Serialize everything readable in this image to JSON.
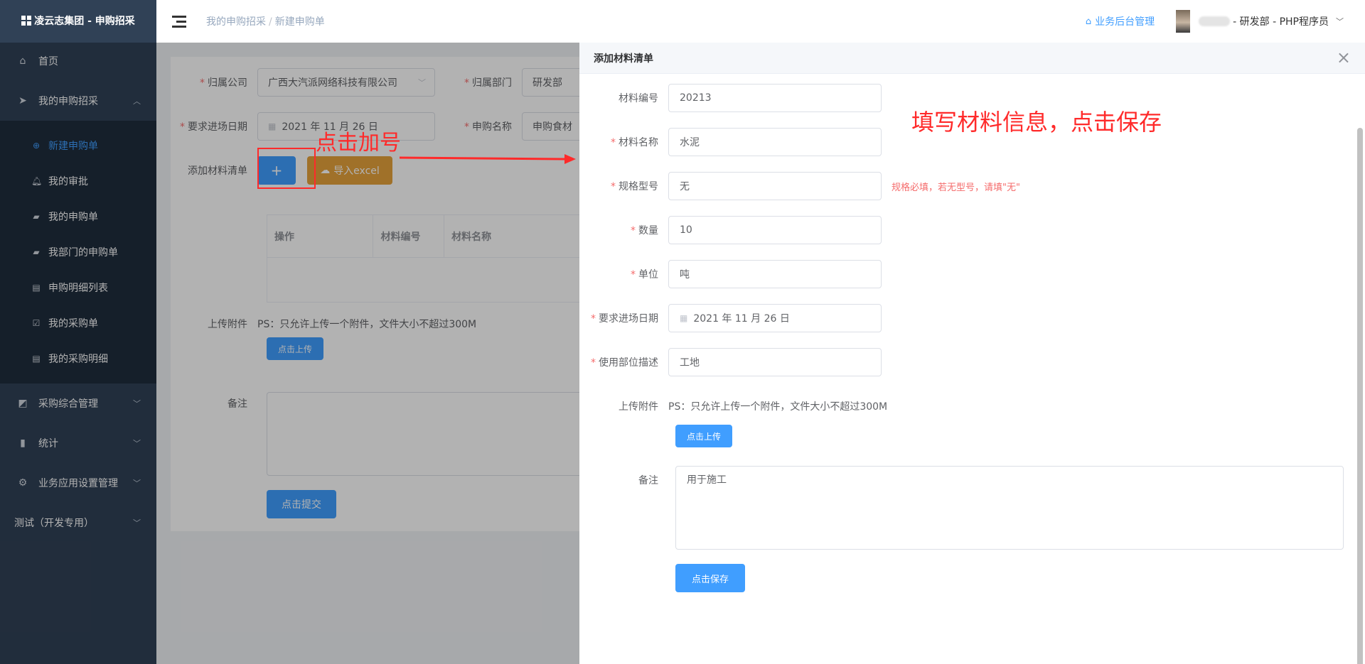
{
  "sidebar": {
    "brand": "凌云志集团 - 申购招采",
    "items": [
      {
        "label": "首页",
        "icon": "home-icon"
      },
      {
        "label": "我的申购招采",
        "icon": "send-icon"
      },
      {
        "label": "采购综合管理",
        "icon": "chart-icon"
      },
      {
        "label": "统计",
        "icon": "bar-chart-icon"
      },
      {
        "label": "业务应用设置管理",
        "icon": "gear-icon"
      },
      {
        "label": "测试（开发专用）",
        "icon": ""
      }
    ],
    "subitems": [
      {
        "label": "新建申购单",
        "icon": "plus-circle-icon",
        "active": true
      },
      {
        "label": "我的审批",
        "icon": "bell-icon"
      },
      {
        "label": "我的申购单",
        "icon": "bag-icon"
      },
      {
        "label": "我部门的申购单",
        "icon": "bag-icon"
      },
      {
        "label": "申购明细列表",
        "icon": "clipboard-icon"
      },
      {
        "label": "我的采购单",
        "icon": "clipboard-check-icon"
      },
      {
        "label": "我的采购明细",
        "icon": "clipboard-icon"
      }
    ]
  },
  "header": {
    "breadcrumb": [
      "我的申购招采",
      "新建申购单"
    ],
    "biz_link": "业务后台管理",
    "user": "- 研发部 - PHP程序员"
  },
  "main_form": {
    "company_label": "归属公司",
    "company_value": "广西大汽派网络科技有限公司",
    "dept_label": "归属部门",
    "dept_value": "研发部",
    "date_label": "要求进场日期",
    "date_value": "2021 年 11 月 26 日",
    "name_label": "申购名称",
    "name_value": "申购食材",
    "materials_label": "添加材料清单",
    "add_button": "+",
    "import_button": "导入excel",
    "table_headers": [
      "操作",
      "材料编号",
      "材料名称"
    ],
    "upload_label": "上传附件",
    "upload_note": "PS：只允许上传一个附件，文件大小不超过300M",
    "upload_button": "点击上传",
    "remark_label": "备注",
    "submit_button": "点击提交"
  },
  "annotations": {
    "click_plus": "点击加号",
    "fill_info": "填写材料信息，点击保存"
  },
  "drawer": {
    "title": "添加材料清单",
    "fields": {
      "code": {
        "label": "材料编号",
        "value": "20213",
        "required": false
      },
      "name": {
        "label": "材料名称",
        "value": "水泥",
        "required": true
      },
      "spec": {
        "label": "规格型号",
        "value": "无",
        "required": true,
        "hint": "规格必填，若无型号，请填\"无\""
      },
      "qty": {
        "label": "数量",
        "value": "10",
        "required": true
      },
      "unit": {
        "label": "单位",
        "value": "吨",
        "required": true
      },
      "date": {
        "label": "要求进场日期",
        "value": "2021 年 11 月 26 日",
        "required": true
      },
      "location": {
        "label": "使用部位描述",
        "value": "工地",
        "required": true
      }
    },
    "upload_label": "上传附件",
    "upload_note": "PS：只允许上传一个附件，文件大小不超过300M",
    "upload_button": "点击上传",
    "remark_label": "备注",
    "remark_value": "用于施工",
    "save_button": "点击保存"
  },
  "colors": {
    "sidebar_bg": "#304156",
    "primary": "#409eff",
    "warning": "#e6a23c",
    "danger": "#f56c6c",
    "annotation": "#ff2a2a"
  }
}
